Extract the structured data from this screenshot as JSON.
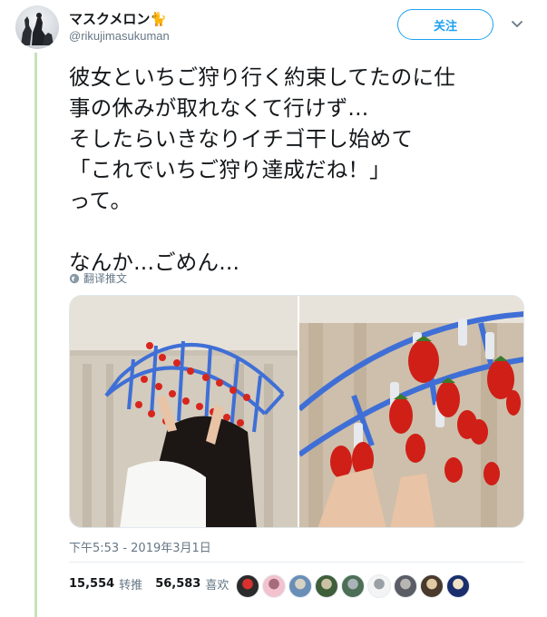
{
  "header": {
    "display_name": "マスクメロン",
    "handle": "@rikujimasukuman",
    "follow_label": "关注"
  },
  "tweet": {
    "text": "彼女といちご狩り行く約束してたのに仕\n事の休みが取れなくて行けず...\nそしたらいきなりイチゴ干し始めて\n「これでいちご狩り達成だね！」\nって。\n\nなんか...ごめん...",
    "translate_label": "翻译推文",
    "timestamp": "下午5:53 - 2019年3月1日"
  },
  "stats": {
    "retweets_count": "15,554",
    "retweets_label": "转推",
    "likes_count": "56,583",
    "likes_label": "喜欢"
  },
  "likers": [
    {
      "name": "liker-avatar-1",
      "color": "#2b2b2b",
      "accent": "#d8312f"
    },
    {
      "name": "liker-avatar-2",
      "color": "#f3c2cf",
      "accent": "#a66c7d"
    },
    {
      "name": "liker-avatar-3",
      "color": "#6a8fb6",
      "accent": "#d7d1c4"
    },
    {
      "name": "liker-avatar-4",
      "color": "#3f5e3a",
      "accent": "#c9c2a4"
    },
    {
      "name": "liker-avatar-5",
      "color": "#4c6f56",
      "accent": "#a9b3b8"
    },
    {
      "name": "liker-avatar-6",
      "color": "#f4f4f4",
      "accent": "#9aa0a6"
    },
    {
      "name": "liker-avatar-7",
      "color": "#5b5d66",
      "accent": "#b8b6b2"
    },
    {
      "name": "liker-avatar-8",
      "color": "#4a3a2d",
      "accent": "#e1c9a4"
    },
    {
      "name": "liker-avatar-9",
      "color": "#1a2e6e",
      "accent": "#f0e2c6"
    }
  ],
  "colors": {
    "accent": "#1da1f2",
    "secondary_text": "#657786",
    "thread_line": "#c4e3b8",
    "strawberry": "#d7261e",
    "hanger": "#3f6fd6"
  },
  "icons": {
    "crown_emoji": "🐈",
    "more": "chevron-down-icon",
    "translate": "globe-icon"
  }
}
